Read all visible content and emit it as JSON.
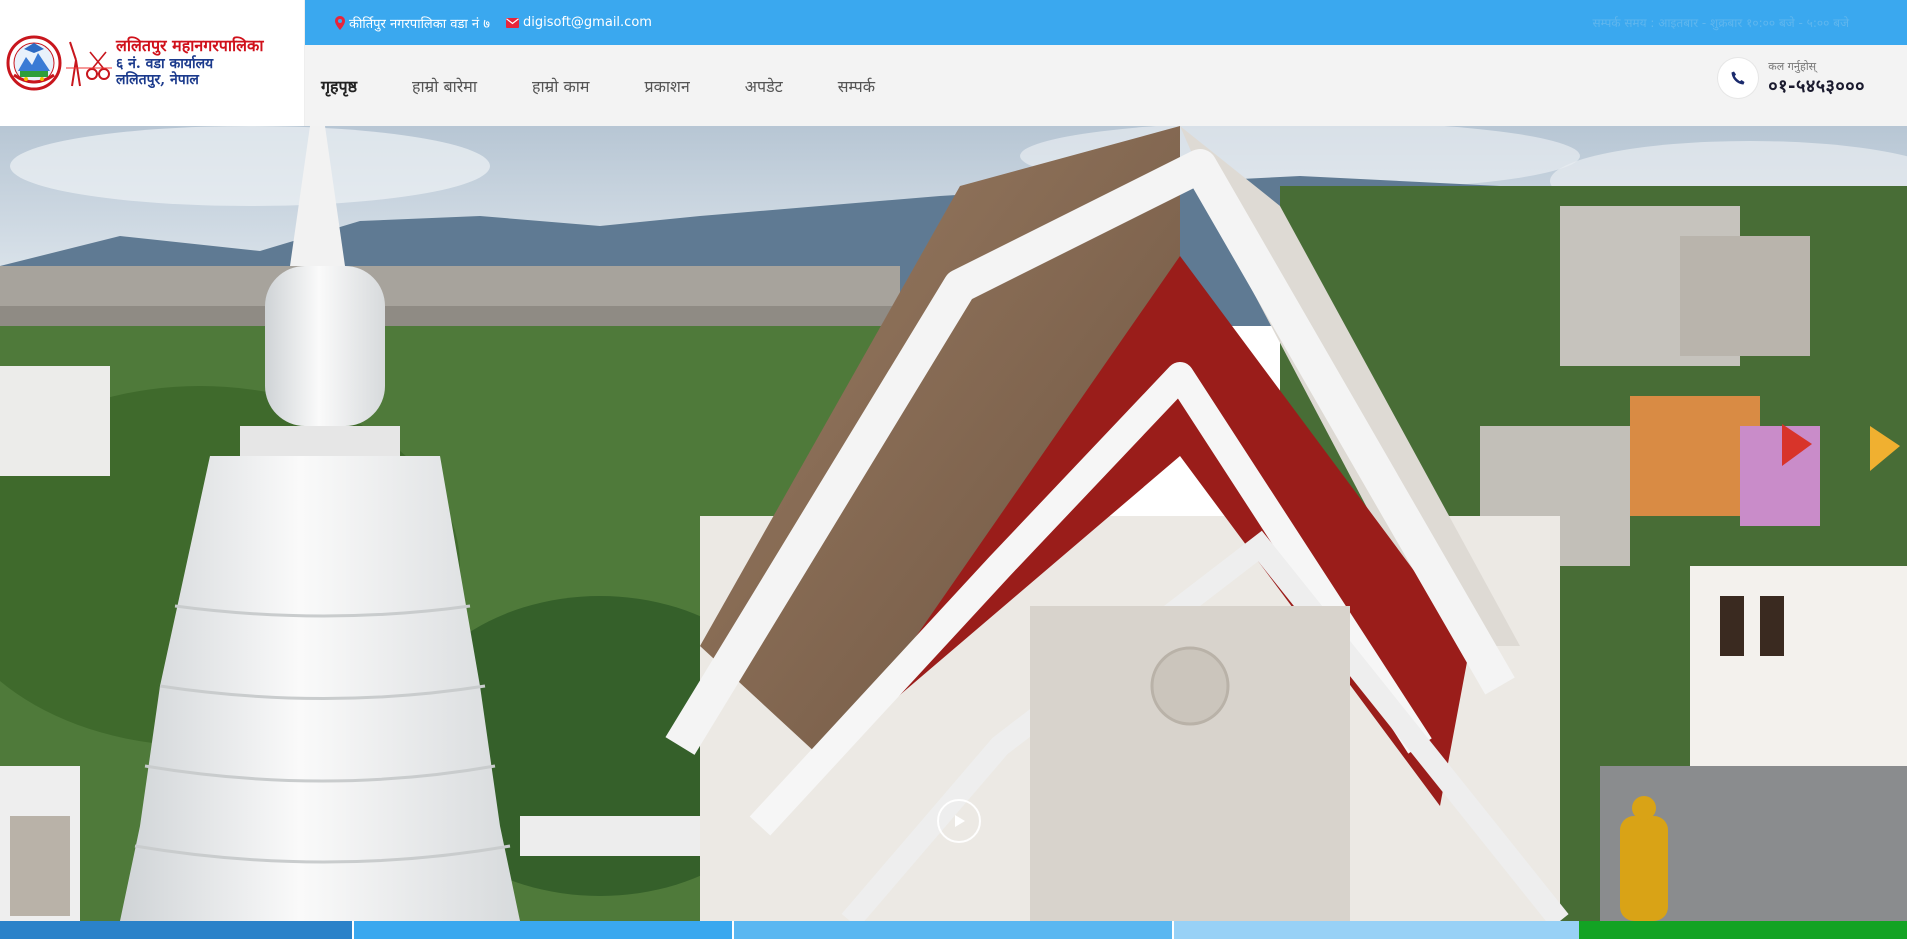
{
  "logo": {
    "line1": "ललितपुर महानगरपालिका",
    "line2": "६ नं. वडा कार्यालय",
    "line3": "ललितपुर, नेपाल"
  },
  "topbar": {
    "address": "कीर्तिपुर नगरपालिका वडा नं ७",
    "email": "digisoft@gmail.com",
    "office_hours": "सम्पर्क समय : आइतबार - शुक्रबार १०:०० बजे - ५:०० बजे",
    "background_color": "#3aa8ef",
    "address_icon": "map-marker-icon",
    "email_icon": "envelope-icon"
  },
  "nav": {
    "items": [
      {
        "label": "गृहपृष्ठ",
        "active": true
      },
      {
        "label": "हाम्रो बारेमा",
        "active": false
      },
      {
        "label": "हाम्रो काम",
        "active": false
      },
      {
        "label": "प्रकाशन",
        "active": false
      },
      {
        "label": "अपडेट",
        "active": false
      },
      {
        "label": "सम्पर्क",
        "active": false
      }
    ]
  },
  "call": {
    "label": "कल गर्नुहोस्",
    "number": "०१-५४५३०००",
    "icon": "phone-icon"
  },
  "hero": {
    "play_icon": "play-icon"
  },
  "strip_colors": [
    "#2b82c9",
    "#3aa8ef",
    "#5ab7f1",
    "#98d1f6",
    "#13a324"
  ]
}
